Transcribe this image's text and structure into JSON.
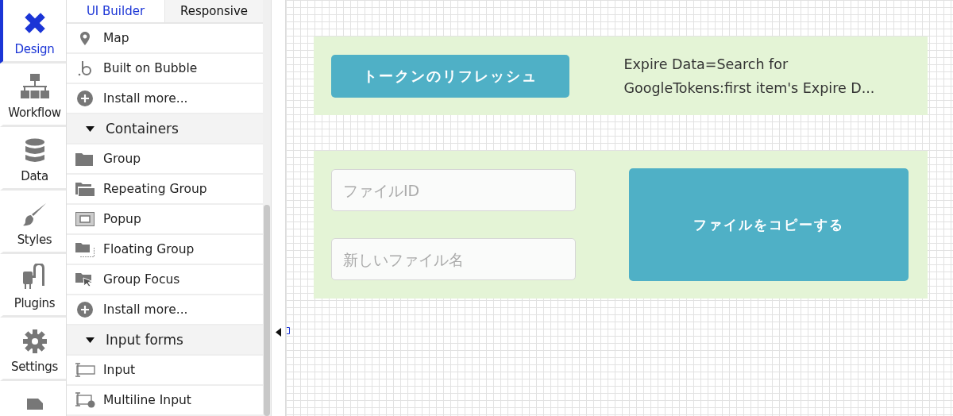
{
  "nav": [
    {
      "kind": "design",
      "label": "Design",
      "selected": true
    },
    {
      "kind": "workflow",
      "label": "Workflow",
      "selected": false
    },
    {
      "kind": "data",
      "label": "Data",
      "selected": false
    },
    {
      "kind": "styles",
      "label": "Styles",
      "selected": false
    },
    {
      "kind": "plugins",
      "label": "Plugins",
      "selected": false
    },
    {
      "kind": "settings",
      "label": "Settings",
      "selected": false
    },
    {
      "kind": "logs",
      "selected": false
    }
  ],
  "tabs": [
    {
      "label": "UI Builder",
      "selected": true
    },
    {
      "label": "Responsive",
      "selected": false
    }
  ],
  "elements": [
    {
      "kind": "map",
      "label": "Map"
    },
    {
      "kind": "bubble",
      "label": "Built on Bubble"
    },
    {
      "kind": "install",
      "label": "Install more..."
    },
    {
      "kind": "header",
      "label": "Containers",
      "expanded": true
    },
    {
      "kind": "group",
      "label": "Group"
    },
    {
      "kind": "repeating",
      "label": "Repeating Group"
    },
    {
      "kind": "popup",
      "label": "Popup"
    },
    {
      "kind": "floating",
      "label": "Floating Group"
    },
    {
      "kind": "focus",
      "label": "Group Focus"
    },
    {
      "kind": "install",
      "label": "Install more..."
    },
    {
      "kind": "header",
      "label": "Input forms",
      "expanded": true
    },
    {
      "kind": "input",
      "label": "Input"
    },
    {
      "kind": "multiline",
      "label": "Multiline Input"
    }
  ],
  "canvas": {
    "refresh_group": {
      "button": "トークンのリフレッシュ",
      "text": "Expire Data=Search for GoogleTokens:first item's Expire D..."
    },
    "copy_group": {
      "file_id": {
        "placeholder": "ファイルID"
      },
      "new_name": {
        "placeholder": "新しいファイル名"
      },
      "button": "ファイルをコピーする"
    }
  }
}
